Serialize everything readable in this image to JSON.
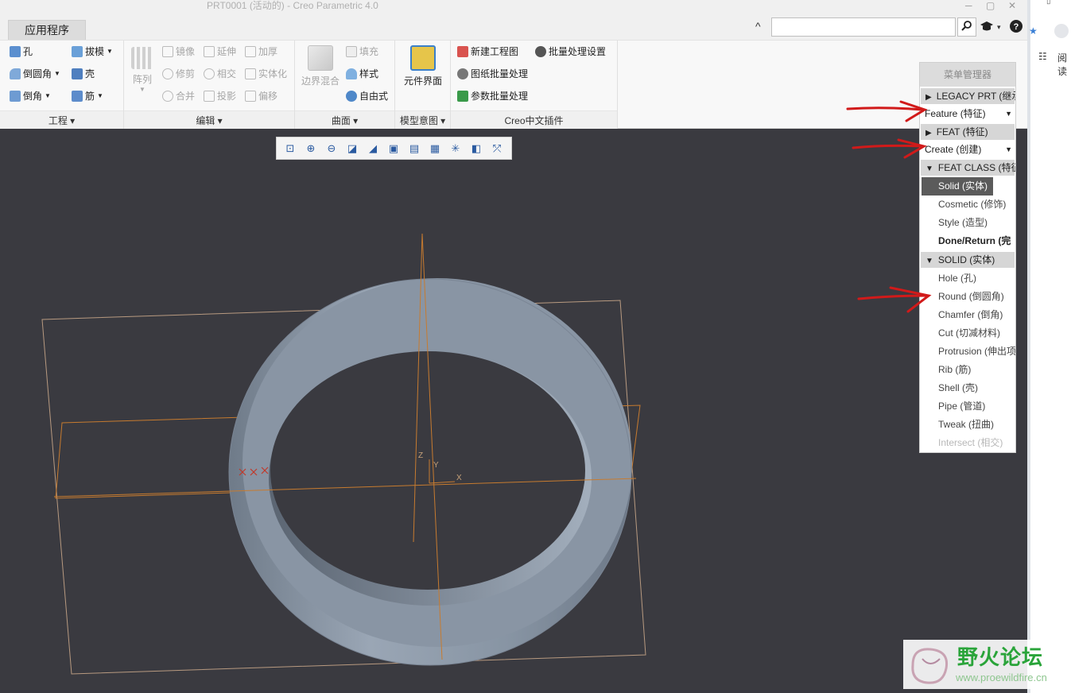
{
  "window": {
    "title": "PRT0001 (活动的) - Creo Parametric 4.0",
    "controls": [
      "─",
      "▢",
      "✕"
    ]
  },
  "tabs": {
    "active": "应用程序",
    "search_placeholder": "",
    "icons": [
      "search-icon",
      "community-icon",
      "help-icon"
    ]
  },
  "ribbon": {
    "groups": {
      "engineering": {
        "label": "工程",
        "items": [
          "孔",
          "拔模",
          "倒圆角",
          "壳",
          "倒角",
          "筋"
        ]
      },
      "edit": {
        "label": "编辑",
        "array": "阵列",
        "items": [
          "镜像",
          "延伸",
          "加厚",
          "修剪",
          "相交",
          "实体化",
          "合并",
          "投影",
          "偏移"
        ]
      },
      "surface": {
        "label": "曲面",
        "boundary": "边界混合",
        "items": [
          "填充",
          "样式",
          "自由式"
        ]
      },
      "model_intent": {
        "label": "模型意图",
        "big": "元件界面"
      },
      "plugin": {
        "label": "Creo中文插件",
        "items": [
          "新建工程图",
          "批量处理设置",
          "图纸批量处理",
          "参数批量处理"
        ]
      }
    }
  },
  "viewport": {
    "axis_labels": [
      "Z",
      "Y",
      "X"
    ]
  },
  "menu_manager": {
    "title": "菜单管理器",
    "legacy": "LEGACY PRT (继承",
    "feature_drop": "Feature (特征)",
    "feat_head": "FEAT (特征)",
    "create_drop": "Create (创建)",
    "feat_class_head": "FEAT CLASS (特征",
    "feat_class_items": [
      "Solid (实体)",
      "Cosmetic (修饰)",
      "Style (造型)",
      "Done/Return (完"
    ],
    "solid_head": "SOLID (实体)",
    "solid_items": [
      "Hole (孔)",
      "Round (倒圆角)",
      "Chamfer (倒角)",
      "Cut (切减材料)",
      "Protrusion (伸出项",
      "Rib (筋)",
      "Shell (壳)",
      "Pipe (管道)",
      "Tweak (扭曲)",
      "Intersect (相交)"
    ]
  },
  "side_panel": {
    "label": "阅读"
  },
  "watermark": {
    "title": "野火论坛",
    "url": "www.proewildfire.cn"
  },
  "colors": {
    "viewport_bg": "#3a3a40",
    "ring": "#8d99a8",
    "datum": "#c77b2f",
    "annotation_red": "#d11a1a",
    "watermark_green": "#2aa43a"
  }
}
